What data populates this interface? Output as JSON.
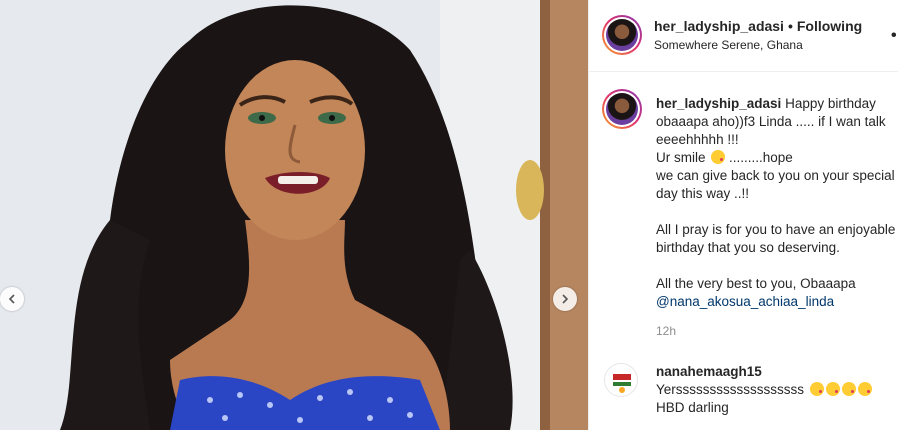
{
  "post": {
    "username": "her_ladyship_adasi",
    "separator": "•",
    "follow_status": "Following",
    "location": "Somewhere Serene, Ghana",
    "more_icon": "•••"
  },
  "caption": {
    "username": "her_ladyship_adasi",
    "line1": "Happy birthday obaaapa aho))f3 Linda ..... if I wan talk eeeehhhhh !!!",
    "line2a": "Ur smile",
    "line2b": ".........hope",
    "line3": "we can give back to you on your special day this way ..!!",
    "line4": "All I pray is for you to have an enjoyable birthday that you so deserving.",
    "line5": "All the very best to you, Obaaapa",
    "mention": "@nana_akosua_achiaa_linda",
    "time": "12h"
  },
  "comment": {
    "username": "nanahemaagh15",
    "text": "Yersssssssssssssssssss",
    "text2": "HBD darling"
  },
  "icons": {
    "prev": "chevron-left-icon",
    "next": "chevron-right-icon",
    "more": "more-horizontal-icon",
    "smile": "smile-emoji",
    "kiss": "kiss-emoji",
    "heart": "heart-icon"
  },
  "colors": {
    "mention": "#00376b",
    "muted": "#8e8e8e",
    "dress": "#2a46c4"
  }
}
